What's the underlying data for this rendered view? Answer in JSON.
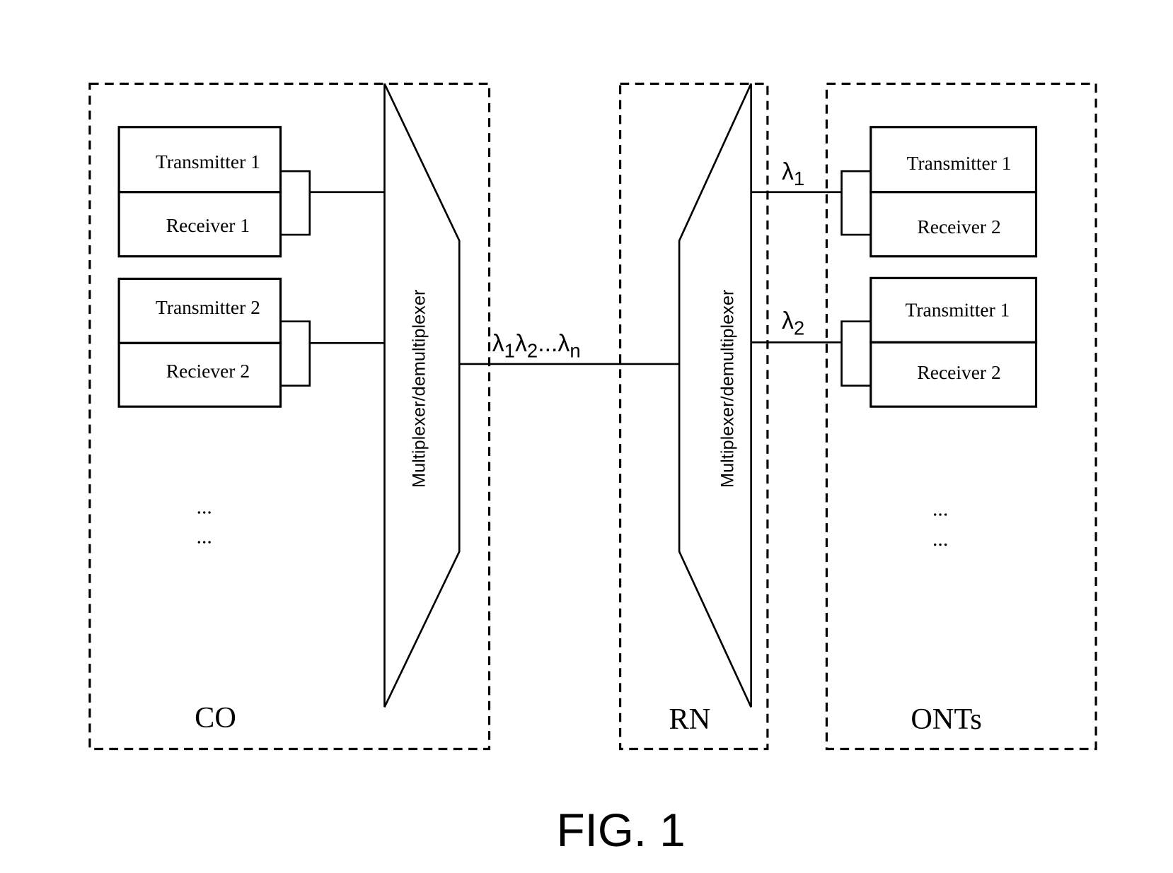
{
  "figure": {
    "caption": "FIG. 1"
  },
  "co": {
    "label": "CO",
    "units": [
      {
        "transmitter": "Transmitter 1",
        "receiver": "Receiver 1"
      },
      {
        "transmitter": "Transmitter 2",
        "receiver": "Reciever 2"
      }
    ],
    "ellipsis": [
      "...",
      "..."
    ],
    "mux_label": "Multiplexer/demultiplexer"
  },
  "link": {
    "label_parts": [
      "λ",
      "1",
      "λ",
      "2",
      "...",
      "λ",
      "n"
    ]
  },
  "rn": {
    "label": "RN",
    "mux_label": "Multiplexer/demultiplexer",
    "outputs": [
      {
        "symbol": "λ",
        "subscript": "1"
      },
      {
        "symbol": "λ",
        "subscript": "2"
      }
    ]
  },
  "onts": {
    "label": "ONTs",
    "units": [
      {
        "transmitter": "Transmitter 1",
        "receiver": "Receiver 2"
      },
      {
        "transmitter": "Transmitter 1",
        "receiver": "Receiver 2"
      }
    ],
    "ellipsis": [
      "...",
      "..."
    ]
  }
}
